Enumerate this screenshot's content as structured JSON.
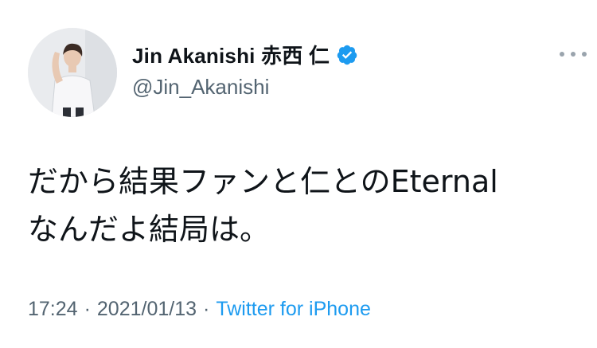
{
  "user": {
    "display_name": "Jin Akanishi  赤西 仁",
    "handle": "@Jin_Akanishi"
  },
  "icons": {
    "verified": "verified-badge-icon",
    "more": "more-options-icon"
  },
  "tweet": {
    "text": "だから結果ファンと仁とのEternal\nなんだよ結局は。",
    "time": "17:24",
    "separator": "·",
    "date": "2021/01/13",
    "source": "Twitter for iPhone"
  },
  "colors": {
    "accent": "#1d9bf0",
    "secondary_text": "#536471",
    "primary_text": "#0f1419"
  }
}
